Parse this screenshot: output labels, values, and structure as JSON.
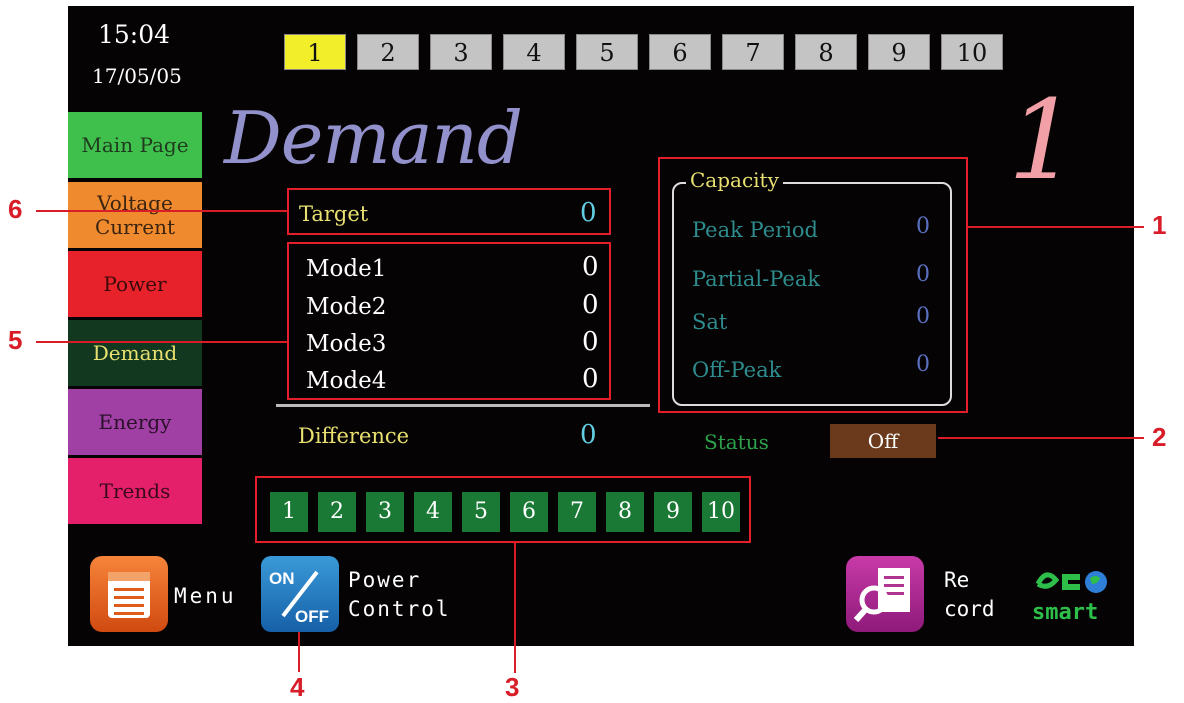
{
  "header": {
    "time": "15:04",
    "date": "17/05/05",
    "page_buttons": [
      "1",
      "2",
      "3",
      "4",
      "5",
      "6",
      "7",
      "8",
      "9",
      "10"
    ]
  },
  "nav": {
    "items": [
      {
        "label": "Main Page",
        "color": "#3fbf4b",
        "text_color": "#1f3a1f"
      },
      {
        "label": "Voltage\nCurrent",
        "color": "#f08a2e",
        "text_color": "#3a2410"
      },
      {
        "label": "Power",
        "color": "#e8222b",
        "text_color": "#3a0a0a"
      },
      {
        "label": "Demand",
        "color": "#123820",
        "text_color": "#e8e070"
      },
      {
        "label": "Energy",
        "color": "#a03fa4",
        "text_color": "#2a102a"
      },
      {
        "label": "Trends",
        "color": "#e5206a",
        "text_color": "#3a0a1a"
      }
    ]
  },
  "main": {
    "title": "Demand",
    "page_number": "1",
    "target_label": "Target",
    "target_value": "0",
    "modes": [
      {
        "label": "Mode1",
        "value": "0"
      },
      {
        "label": "Mode2",
        "value": "0"
      },
      {
        "label": "Mode3",
        "value": "0"
      },
      {
        "label": "Mode4",
        "value": "0"
      }
    ],
    "difference_label": "Difference",
    "difference_value": "0",
    "capacity": {
      "title": "Capacity",
      "rows": [
        {
          "label": "Peak Period",
          "value": "0"
        },
        {
          "label": "Partial-Peak",
          "value": "0"
        },
        {
          "label": "Sat",
          "value": "0"
        },
        {
          "label": "Off-Peak",
          "value": "0"
        }
      ]
    },
    "status_label": "Status",
    "status_value": "Off",
    "channel_buttons": [
      "1",
      "2",
      "3",
      "4",
      "5",
      "6",
      "7",
      "8",
      "9",
      "10"
    ]
  },
  "footer": {
    "menu_label": "Menu",
    "power_icon_on": "ON",
    "power_icon_off": "OFF",
    "power_label_1": "Power",
    "power_label_2": "Control",
    "record_label_1": "Re",
    "record_label_2": "cord",
    "logo_text": "smart"
  },
  "callouts": [
    "1",
    "2",
    "3",
    "4",
    "5",
    "6"
  ],
  "icons": [
    "menu-icon",
    "power-toggle-icon",
    "record-search-icon",
    "eco-smart-logo"
  ]
}
